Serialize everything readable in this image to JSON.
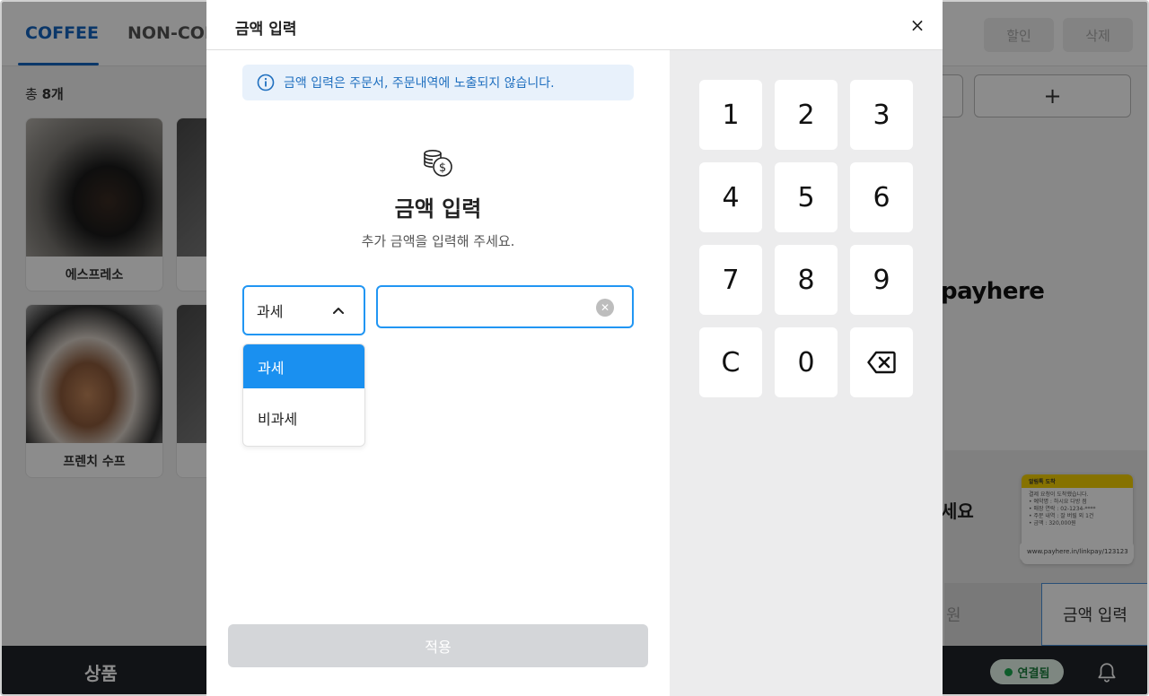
{
  "background": {
    "tabs": [
      "COFFEE",
      "NON-COF"
    ],
    "top_buttons": [
      "할인",
      "삭제"
    ],
    "count_prefix": "총 ",
    "count_value": "8개",
    "products": [
      {
        "name": "에스프레소"
      },
      {
        "name": "프렌치 수프"
      }
    ],
    "plus_label": "+",
    "brand": "payhere",
    "promo_text": "세요",
    "notice": {
      "header": "알림톡 도착",
      "line1": "결제 요청이 도착했습니다.",
      "line2": "• 예약명 : 하시요 다방 점",
      "line3": "• 매장 연락 : 02-1234-****",
      "line4": "• 주문 내역 : 잘 버릴 외 1건",
      "line5": "• 금액 : 320,000원",
      "link": "www.payhere.in/linkpay/123123"
    },
    "total_partial": "원",
    "amount_button": "금액 입력",
    "bottom_label": "상품",
    "connection": "연결됨"
  },
  "modal": {
    "title": "금액 입력",
    "close_symbol": "×",
    "info": "금액 입력은 주문서, 주문내역에 노출되지 않습니다.",
    "heading": "금액 입력",
    "subheading": "추가 금액을 입력해 주세요.",
    "tax_selected": "과세",
    "tax_options": [
      "과세",
      "비과세"
    ],
    "amount_value": "",
    "apply_label": "적용",
    "keypad": [
      "1",
      "2",
      "3",
      "4",
      "5",
      "6",
      "7",
      "8",
      "9",
      "C",
      "0"
    ]
  },
  "colors": {
    "accent": "#2196f3",
    "selected_option": "#1a90f0",
    "info_text": "#1f6fbf",
    "info_bg": "#e8f1fb",
    "keypad_bg": "#ececed"
  }
}
